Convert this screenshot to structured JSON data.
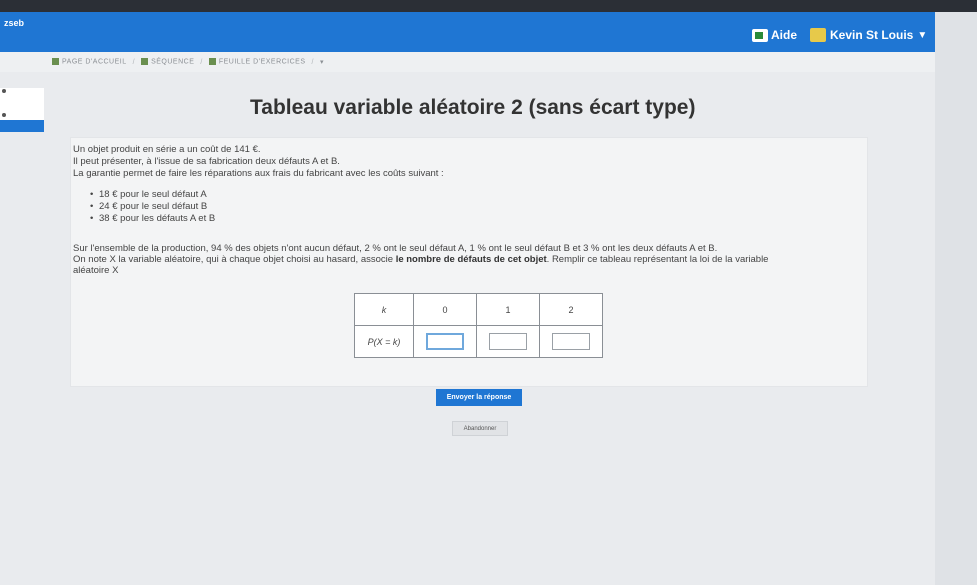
{
  "header": {
    "brand": "zseb",
    "help_label": "Aide",
    "user_name": "Kevin St Louis"
  },
  "breadcrumb": {
    "items": [
      "PAGE D'ACCUEIL",
      "SÉQUENCE",
      "FEUILLE D'EXERCICES"
    ]
  },
  "page": {
    "title": "Tableau variable aléatoire 2 (sans écart type)"
  },
  "exercise": {
    "intro_1": "Un objet produit en série a un coût de 141 €.",
    "intro_2": "Il peut présenter, à l'issue de sa fabrication deux défauts A et B.",
    "intro_3": "La garantie permet de faire les réparations aux frais du fabricant avec les coûts suivant :",
    "costs": [
      "18 € pour le seul défaut A",
      "24 € pour le seul défaut B",
      "38 € pour les défauts A et B"
    ],
    "stats": "Sur l'ensemble de la production, 94 % des objets n'ont aucun défaut, 2 % ont le seul défaut A, 1 % ont le seul défaut B et 3 % ont les deux défauts A et B.",
    "question_part1": "On note X la variable aléatoire, qui à chaque objet choisi au hasard, associe",
    "question_bold": "le nombre de défauts de cet objet",
    "question_part2": ". Remplir ce tableau représentant la loi de la variable",
    "question_end": "aléatoire X"
  },
  "table": {
    "row1_header": "k",
    "row2_header": "P(X = k)",
    "values": [
      "0",
      "1",
      "2"
    ],
    "answers": [
      "",
      "",
      ""
    ]
  },
  "actions": {
    "submit_label": "Envoyer la réponse",
    "abandon_label": "Abandonner"
  }
}
